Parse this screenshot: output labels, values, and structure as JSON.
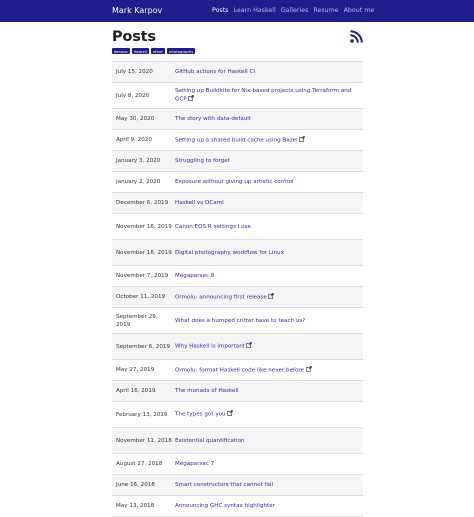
{
  "navbar": {
    "brand": "Mark Karpov",
    "links": [
      "Posts",
      "Learn Haskell",
      "Galleries",
      "Resume",
      "About me"
    ],
    "active": "Posts",
    "color": "#1d1d8c"
  },
  "page": {
    "title": "Posts",
    "tags": [
      "devops",
      "haskell",
      "other",
      "photography"
    ],
    "rss_icon": "rss-feed-icon",
    "link_color": "#2a2ab8"
  },
  "posts": [
    {
      "date": "July 15, 2020",
      "title": "GitHub actions for Haskell CI",
      "external": false
    },
    {
      "date": "July 8, 2020",
      "title": "Setting up Buildkite for Nix-based projects using Terraform and GCP",
      "external": true
    },
    {
      "date": "May 30, 2020",
      "title": "The story with data-default",
      "external": false
    },
    {
      "date": "April 9, 2020",
      "title": "Setting up a shared build cache using Bazel",
      "external": true
    },
    {
      "date": "January 3, 2020",
      "title": "Struggling to forget",
      "external": false
    },
    {
      "date": "January 2, 2020",
      "title": "Exposure without giving up artistic control",
      "external": false
    },
    {
      "date": "December 6, 2019",
      "title": "Haskell vs OCaml",
      "external": false
    },
    {
      "date": "November 16, 2019",
      "title": "Canon EOS R settings I use",
      "external": false
    },
    {
      "date": "November 16, 2019",
      "title": "Digital photography workflow for Linux",
      "external": false
    },
    {
      "date": "November 7, 2019",
      "title": "Megaparsec 8",
      "external": false
    },
    {
      "date": "October 11, 2019",
      "title": "Ormolu: announcing first release",
      "external": true
    },
    {
      "date": "September 29, 2019",
      "title": "What does a humped critter have to teach us?",
      "external": false
    },
    {
      "date": "September 6, 2019",
      "title": "Why Haskell is important",
      "external": true
    },
    {
      "date": "May 27, 2019",
      "title": "Ormolu: format Haskell code like never before",
      "external": true
    },
    {
      "date": "April 16, 2019",
      "title": "The monads of Haskell",
      "external": false
    },
    {
      "date": "February 13, 2019",
      "title": "The types got you",
      "external": true
    },
    {
      "date": "November 11, 2018",
      "title": "Existential quantification",
      "external": false
    },
    {
      "date": "August 27, 2018",
      "title": "Megaparsec 7",
      "external": false
    },
    {
      "date": "June 16, 2018",
      "title": "Smart constructors that cannot fail",
      "external": false
    },
    {
      "date": "May 13, 2018",
      "title": "Announcing GHC syntax highlighter",
      "external": false
    }
  ]
}
